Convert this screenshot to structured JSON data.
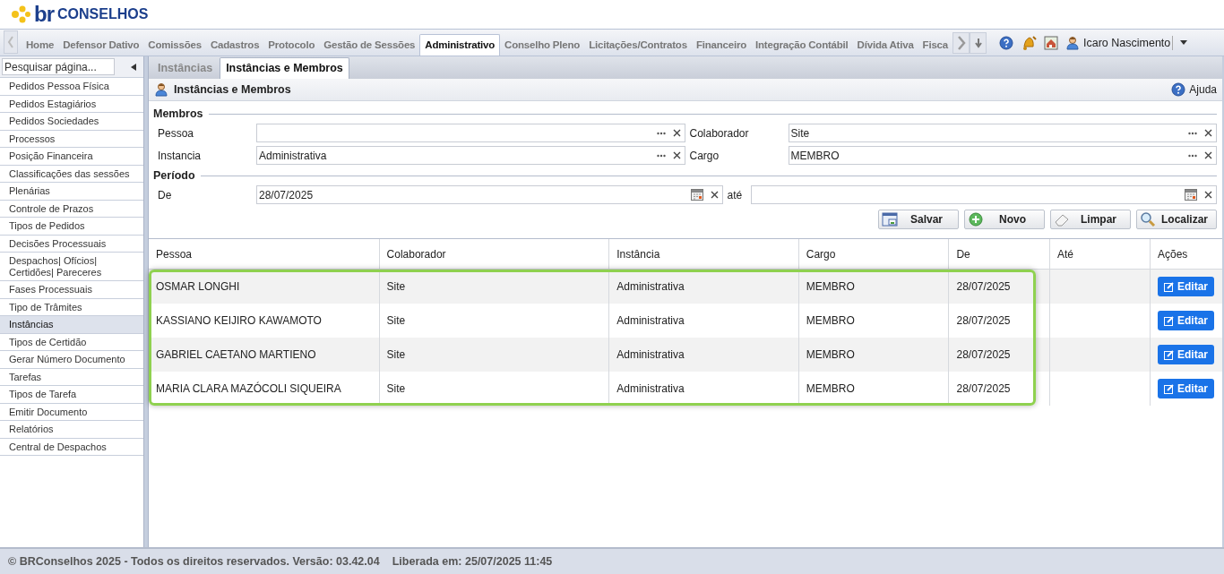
{
  "header": {
    "logo_mark": "br",
    "logo_text": "CONSELHOS"
  },
  "nav": {
    "tabs": [
      {
        "label": "Home",
        "selected": false
      },
      {
        "label": "Defensor Dativo",
        "selected": false
      },
      {
        "label": "Comissões",
        "selected": false
      },
      {
        "label": "Cadastros",
        "selected": false
      },
      {
        "label": "Protocolo",
        "selected": false
      },
      {
        "label": "Gestão de Sessões",
        "selected": false
      },
      {
        "label": "Administrativo",
        "selected": true
      },
      {
        "label": "Conselho Pleno",
        "selected": false
      },
      {
        "label": "Licitações/Contratos",
        "selected": false
      },
      {
        "label": "Financeiro",
        "selected": false
      },
      {
        "label": "Integração Contábil",
        "selected": false
      },
      {
        "label": "Dívida Ativa",
        "selected": false
      },
      {
        "label": "Fisca",
        "selected": false
      }
    ],
    "user": "Icaro Nascimento"
  },
  "sidebar": {
    "search": {
      "placeholder": "Pesquisar página..."
    },
    "items": [
      {
        "label": "Pedidos Pessoa Física",
        "selected": false
      },
      {
        "label": "Pedidos Estagiários",
        "selected": false
      },
      {
        "label": "Pedidos Sociedades",
        "selected": false
      },
      {
        "label": "Processos",
        "selected": false
      },
      {
        "label": "Posição Financeira",
        "selected": false
      },
      {
        "label": "Classificações das sessões",
        "selected": false
      },
      {
        "label": "Plenárias",
        "selected": false
      },
      {
        "label": "Controle de Prazos",
        "selected": false
      },
      {
        "label": "Tipos de Pedidos",
        "selected": false
      },
      {
        "label": "Decisões Processuais",
        "selected": false
      },
      {
        "label": "Despachos| Ofícios| Certidões| Pareceres",
        "selected": false
      },
      {
        "label": "Fases Processuais",
        "selected": false
      },
      {
        "label": "Tipo de Trâmites",
        "selected": false
      },
      {
        "label": "Instâncias",
        "selected": true
      },
      {
        "label": "Tipos de Certidão",
        "selected": false
      },
      {
        "label": "Gerar Número Documento",
        "selected": false
      },
      {
        "label": "Tarefas",
        "selected": false
      },
      {
        "label": "Tipos de Tarefa",
        "selected": false
      },
      {
        "label": "Emitir Documento",
        "selected": false
      },
      {
        "label": "Relatórios",
        "selected": false
      },
      {
        "label": "Central de Despachos",
        "selected": false
      }
    ]
  },
  "subtabs": [
    {
      "label": "Instâncias",
      "selected": false
    },
    {
      "label": "Instâncias e Membros",
      "selected": true
    }
  ],
  "panel": {
    "title": "Instâncias e Membros",
    "help": "Ajuda"
  },
  "form": {
    "members_title": "Membros",
    "members": [
      {
        "label": "Pessoa",
        "kind": "lookup"
      },
      {
        "label": "Colaborador",
        "value": "Site",
        "kind": "lookup"
      },
      {
        "label": "Instancia",
        "value": "Administrativa",
        "kind": "lookup"
      },
      {
        "label": "Cargo",
        "value": "MEMBRO",
        "kind": "lookup"
      }
    ],
    "period_title": "Período",
    "period": [
      {
        "label": "De",
        "value": "28/07/2025",
        "kind": "date"
      },
      {
        "label": "até",
        "kind": "date"
      }
    ],
    "buttons": [
      {
        "label": "Salvar",
        "kind": "save"
      },
      {
        "label": "Novo",
        "kind": "new"
      },
      {
        "label": "Limpar",
        "kind": "clear"
      },
      {
        "label": "Localizar",
        "kind": "search"
      }
    ]
  },
  "table": {
    "highlighted": true,
    "columns": [
      "Pessoa",
      "Colaborador",
      "Instância",
      "Cargo",
      "De",
      "Até",
      "Ações"
    ],
    "rows": [
      {
        "cells": [
          "OSMAR LONGHI",
          "Site",
          "Administrativa",
          "MEMBRO",
          "28/07/2025"
        ],
        "action": "Editar"
      },
      {
        "cells": [
          "KASSIANO KEIJIRO KAWAMOTO",
          "Site",
          "Administrativa",
          "MEMBRO",
          "28/07/2025"
        ],
        "action": "Editar"
      },
      {
        "cells": [
          "GABRIEL CAETANO MARTIENO",
          "Site",
          "Administrativa",
          "MEMBRO",
          "28/07/2025"
        ],
        "action": "Editar"
      },
      {
        "cells": [
          "MARIA CLARA MAZÓCOLI SIQUEIRA",
          "Site",
          "Administrativa",
          "MEMBRO",
          "28/07/2025"
        ],
        "action": "Editar"
      }
    ]
  },
  "footer": {
    "copyright": "© BRConselhos 2025 - Todos os direitos reservados. Versão: 03.42.04",
    "released": "Liberada em: 25/07/2025 11:45"
  }
}
